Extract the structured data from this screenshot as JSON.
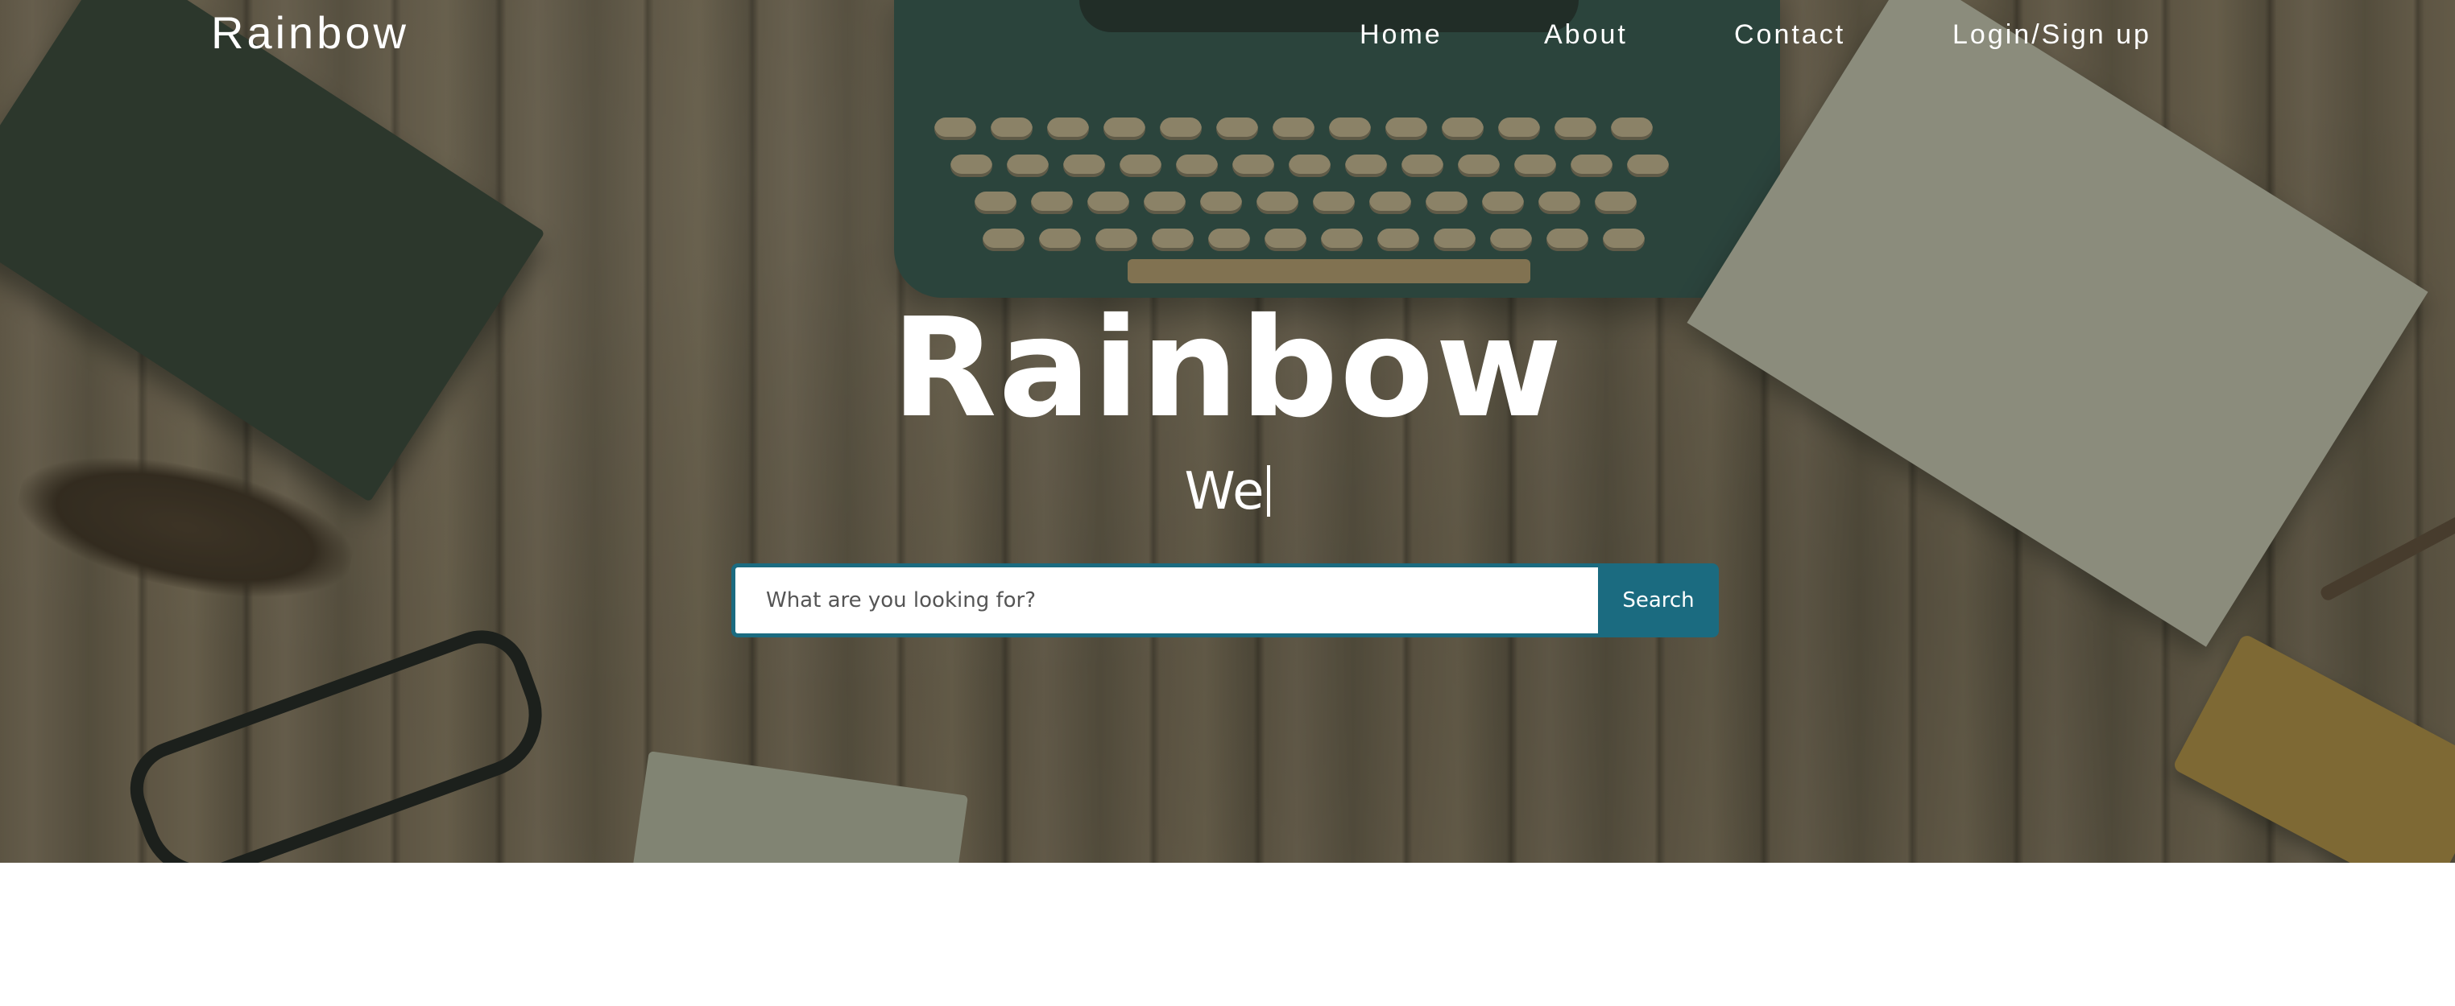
{
  "nav": {
    "brand": "Rainbow",
    "links": {
      "home": "Home",
      "about": "About",
      "contact": "Contact",
      "login": "Login/Sign up"
    }
  },
  "hero": {
    "title": "Rainbow",
    "subtitle": "We"
  },
  "search": {
    "placeholder": "What are you looking for?",
    "value": "",
    "button_label": "Search"
  },
  "colors": {
    "accent": "#1b6b80",
    "text_on_hero": "#ffffff",
    "page_background": "#ffffff"
  },
  "icons": {
    "text_caret": "text-cursor-icon"
  }
}
